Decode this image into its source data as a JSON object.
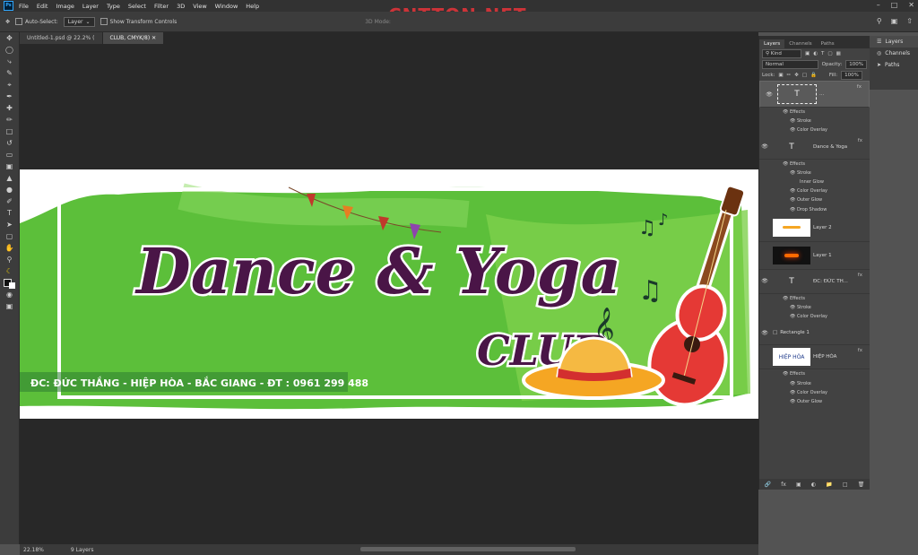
{
  "app": {
    "logo": "Ps",
    "menu": [
      "File",
      "Edit",
      "Image",
      "Layer",
      "Type",
      "Select",
      "Filter",
      "3D",
      "View",
      "Window",
      "Help"
    ],
    "watermark": "CNTTQN.NET"
  },
  "options": {
    "auto_select_label": "Auto-Select:",
    "auto_select_value": "Layer",
    "show_transform": "Show Transform Controls",
    "mode_3d": "3D Mode:"
  },
  "doc_tabs": [
    {
      "label": "Untitled-1.psd @ 22.2% (",
      "active": false
    },
    {
      "label": "CLUB, CMYK/8)",
      "active": true
    }
  ],
  "status": {
    "zoom": "22.18%",
    "layers": "9 Layers"
  },
  "artwork": {
    "title_main": "Dance & Yoga",
    "title_club": "CLUB",
    "address": "ĐC: ĐỨC THẮNG - HIỆP HÒA - BẮC GIANG - ĐT : 0961 299 488",
    "colors": {
      "green": "#5cbf3a",
      "purple": "#4a1547",
      "orange": "#f5a623",
      "guitar_red": "#e53935"
    }
  },
  "panel": {
    "tabs": [
      "Layers",
      "Channels",
      "Paths"
    ],
    "kind": "Kind",
    "blend": "Normal",
    "opacity_label": "Opacity:",
    "opacity": "100%",
    "lock_label": "Lock:",
    "fill_label": "Fill:",
    "fill": "100%",
    "layers": [
      {
        "name": "...",
        "type": "text",
        "selected": true,
        "fx": true,
        "effects": [
          "Stroke",
          "Color Overlay"
        ]
      },
      {
        "name": "Dance & Yoga",
        "type": "text",
        "fx": true,
        "effects": [
          "Stroke",
          "Inner Glow",
          "Color Overlay",
          "Outer Glow",
          "Drop Shadow"
        ]
      },
      {
        "name": "Layer 2",
        "type": "image"
      },
      {
        "name": "Layer 1",
        "type": "image"
      },
      {
        "name": "ĐC: ĐỨC TH...",
        "type": "text",
        "fx": true,
        "effects": [
          "Stroke",
          "Color Overlay"
        ]
      },
      {
        "name": "Rectangle 1",
        "type": "shape"
      },
      {
        "name": "HIỆP HÒA",
        "type": "image",
        "fx": true,
        "effects": [
          "Stroke",
          "Color Overlay",
          "Outer Glow"
        ]
      }
    ],
    "effects_label": "Effects"
  },
  "dock": [
    "Layers",
    "Channels",
    "Paths"
  ]
}
